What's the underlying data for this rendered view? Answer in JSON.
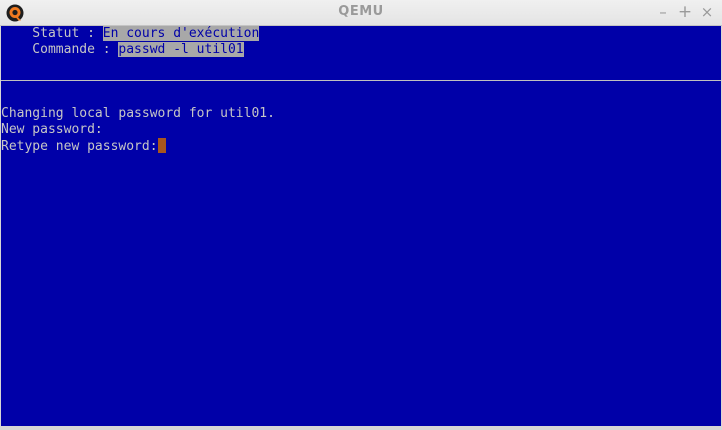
{
  "window": {
    "title": "QEMU",
    "app_icon": "qemu-logo-icon",
    "buttons": {
      "minimize": "–",
      "maximize": "+",
      "close": "×"
    }
  },
  "terminal": {
    "background_color": "#0000a8",
    "text_color": "#c6c6c6",
    "highlight_color": "#a8a8a8",
    "cursor_color": "#a8561e",
    "status": {
      "label": "    Statut : ",
      "value": "En cours d'exécution"
    },
    "command": {
      "label": "    Commande : ",
      "value": "passwd -l util01"
    },
    "output": [
      "Changing local password for util01.",
      "New password:",
      "Retype new password:"
    ]
  }
}
